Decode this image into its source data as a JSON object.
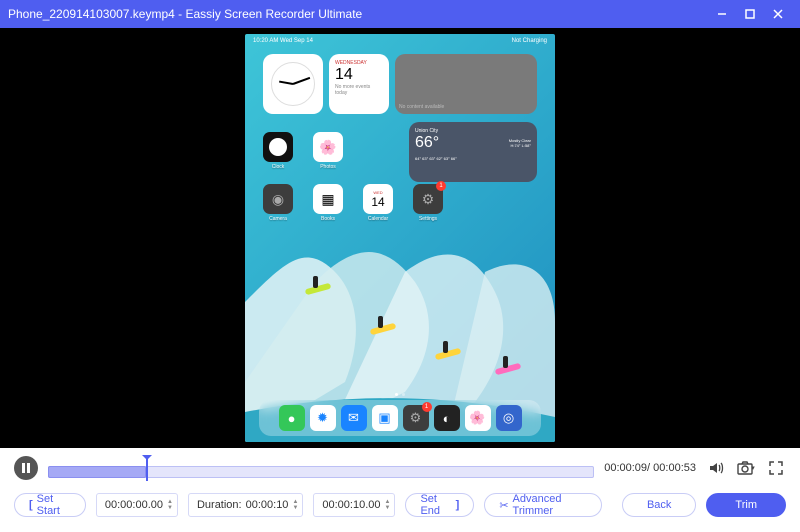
{
  "title": "Phone_220914103007.keymp4  -  Eassiy Screen Recorder Ultimate",
  "ipad": {
    "time": "10:20 AM",
    "date": "Wed Sep 14",
    "battery": "Not Charging",
    "calendar": {
      "dayname": "WEDNESDAY",
      "daynum": "14",
      "note": "No more events today"
    },
    "gray_widget": "No content available",
    "weather": {
      "city": "Union City",
      "temp": "66°",
      "cond": "Mostly Clear",
      "range": "H:74° L:58°",
      "hourly": "64° 63° 63° 62° 63° 66°"
    },
    "apps_r1": [
      {
        "label": "Clock",
        "bg": "#111",
        "glyph": "●"
      },
      {
        "label": "Photos",
        "bg": "#fff",
        "glyph": "✿"
      }
    ],
    "apps_r2": [
      {
        "label": "Camera",
        "bg": "#3d3d3d",
        "glyph": "◉"
      },
      {
        "label": "Books",
        "bg": "#fff",
        "glyph": "▦"
      },
      {
        "label": "Calendar",
        "bg": "#fff",
        "glyph": "14",
        "sub": "WED"
      },
      {
        "label": "Settings",
        "bg": "#3d3d3d",
        "glyph": "⚙",
        "badge": "1"
      }
    ],
    "dock": [
      {
        "name": "messages",
        "bg": "#34c759",
        "glyph": "✉"
      },
      {
        "name": "safari",
        "bg": "#fff",
        "glyph": "✹"
      },
      {
        "name": "mail",
        "bg": "#1a84ff",
        "glyph": "✉"
      },
      {
        "name": "files",
        "bg": "#fff",
        "glyph": "▣"
      },
      {
        "name": "settings",
        "bg": "#3d3d3d",
        "glyph": "⚙",
        "badge": "1"
      },
      {
        "name": "app6",
        "bg": "#222",
        "glyph": "◐"
      },
      {
        "name": "photos",
        "bg": "#fff",
        "glyph": "✿"
      },
      {
        "name": "app8",
        "bg": "#36c",
        "glyph": "◎"
      }
    ]
  },
  "player": {
    "current": "00:00:09",
    "total": "00:00:53"
  },
  "trimmer": {
    "set_start": "Set Start",
    "start_time": "00:00:00.00",
    "duration_label": "Duration:",
    "duration_value": "00:00:10",
    "end_time": "00:00:10.00",
    "set_end": "Set End",
    "advanced": "Advanced Trimmer",
    "back": "Back",
    "trim": "Trim"
  }
}
